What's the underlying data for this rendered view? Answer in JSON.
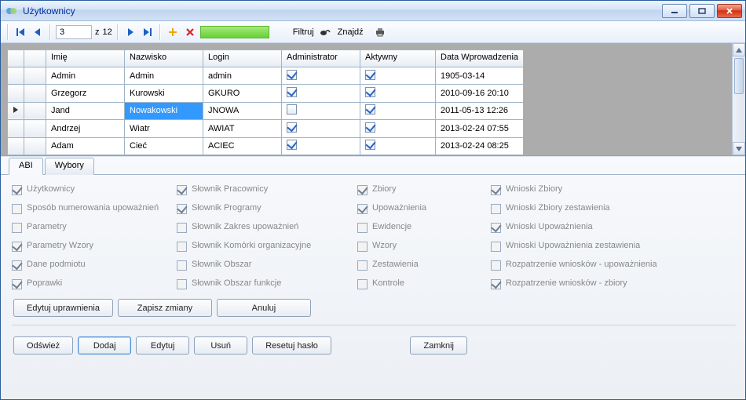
{
  "window": {
    "title": "Użytkownicy"
  },
  "nav": {
    "page": "3",
    "total_prefix": "z ",
    "total": "12"
  },
  "toolbar": {
    "filter": "Filtruj",
    "find": "Znajdź"
  },
  "grid": {
    "columns": {
      "imie": "Imię",
      "nazwisko": "Nazwisko",
      "login": "Login",
      "admin": "Administrator",
      "active": "Aktywny",
      "date": "Data Wprowadzenia"
    },
    "rows": [
      {
        "imie": "Admin",
        "nazwisko": "Admin",
        "login": "admin",
        "admin": true,
        "active": true,
        "date": "1905-03-14"
      },
      {
        "imie": "Grzegorz",
        "nazwisko": "Kurowski",
        "login": "GKURO",
        "admin": true,
        "active": true,
        "date": "2010-09-16 20:10"
      },
      {
        "imie": "Jand",
        "nazwisko": "Nowakowski",
        "login": "JNOWA",
        "admin": false,
        "active": true,
        "date": "2011-05-13 12:26",
        "current": true,
        "selectedCell": "nazwisko"
      },
      {
        "imie": "Andrzej",
        "nazwisko": "Wiatr",
        "login": "AWIAT",
        "admin": true,
        "active": true,
        "date": "2013-02-24 07:55"
      },
      {
        "imie": "Adam",
        "nazwisko": "Cieć",
        "login": "ACIEC",
        "admin": true,
        "active": true,
        "date": "2013-02-24 08:25"
      }
    ]
  },
  "tabs": {
    "abi": "ABI",
    "wybory": "Wybory"
  },
  "perms": [
    [
      {
        "k": "uzytkownicy",
        "label": "Użytkownicy",
        "checked": true,
        "disabled": true
      },
      {
        "k": "slownik-pracownicy",
        "label": "Słownik Pracownicy",
        "checked": true,
        "disabled": true
      },
      {
        "k": "zbiory",
        "label": "Zbiory",
        "checked": true,
        "disabled": true
      },
      {
        "k": "wnioski-zbiory",
        "label": "Wnioski Zbiory",
        "checked": true,
        "disabled": true
      }
    ],
    [
      {
        "k": "sposob-numerowania",
        "label": "Sposób numerowania upoważnień",
        "checked": false,
        "disabled": true
      },
      {
        "k": "slownik-programy",
        "label": "Słownik Programy",
        "checked": true,
        "disabled": true
      },
      {
        "k": "upowaznienia",
        "label": "Upoważnienia",
        "checked": true,
        "disabled": true
      },
      {
        "k": "wnioski-zbiory-zest",
        "label": "Wnioski Zbiory zestawienia",
        "checked": false,
        "disabled": true
      }
    ],
    [
      {
        "k": "parametry",
        "label": "Parametry",
        "checked": false,
        "disabled": true
      },
      {
        "k": "slownik-zakres",
        "label": "Słownik Zakres upoważnień",
        "checked": false,
        "disabled": true
      },
      {
        "k": "ewidencje",
        "label": "Ewidencje",
        "checked": false,
        "disabled": true
      },
      {
        "k": "wnioski-upowaznienia",
        "label": "Wnioski Upoważnienia",
        "checked": true,
        "disabled": true
      }
    ],
    [
      {
        "k": "parametry-wzory",
        "label": "Parametry Wzory",
        "checked": true,
        "disabled": true
      },
      {
        "k": "slownik-komorki",
        "label": "Słownik Komórki organizacyjne",
        "checked": false,
        "disabled": true
      },
      {
        "k": "wzory",
        "label": "Wzory",
        "checked": false,
        "disabled": true
      },
      {
        "k": "wnioski-upowaznienia-zest",
        "label": "Wnioski Upoważnienia zestawienia",
        "checked": false,
        "disabled": true
      }
    ],
    [
      {
        "k": "dane-podmiotu",
        "label": "Dane podmiotu",
        "checked": true,
        "disabled": true
      },
      {
        "k": "slownik-obszar",
        "label": "Słownik Obszar",
        "checked": false,
        "disabled": true
      },
      {
        "k": "zestawienia",
        "label": "Zestawienia",
        "checked": false,
        "disabled": true
      },
      {
        "k": "rozpatrzenie-upowaznienia",
        "label": "Rozpatrzenie wniosków - upoważnienia",
        "checked": false,
        "disabled": true
      }
    ],
    [
      {
        "k": "poprawki",
        "label": "Poprawki",
        "checked": true,
        "disabled": true
      },
      {
        "k": "slownik-obszar-funkcje",
        "label": "Słownik Obszar funkcje",
        "checked": false,
        "disabled": true
      },
      {
        "k": "kontrole",
        "label": "Kontrole",
        "checked": false,
        "disabled": true
      },
      {
        "k": "rozpatrzenie-zbiory",
        "label": "Rozpatrzenie wniosków - zbiory",
        "checked": true,
        "disabled": true
      }
    ]
  ],
  "buttons": {
    "edit_perms": "Edytuj uprawnienia",
    "save_changes": "Zapisz zmiany",
    "cancel": "Anuluj",
    "refresh": "Odśwież",
    "add": "Dodaj",
    "edit": "Edytuj",
    "delete": "Usuń",
    "reset_pw": "Resetuj hasło",
    "close": "Zamknij"
  }
}
